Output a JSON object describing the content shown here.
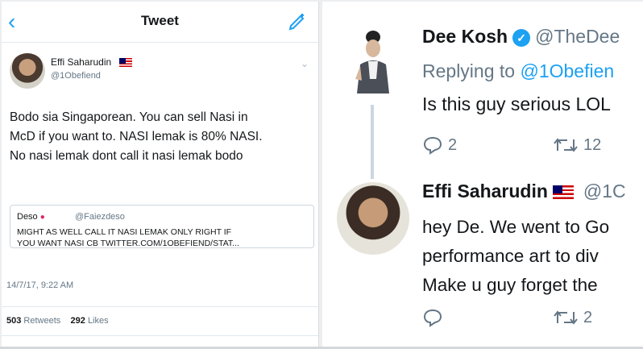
{
  "left": {
    "header_title": "Tweet",
    "back_icon": "‹",
    "author_name": "Effi Saharudin",
    "author_handle": "@1Obefiend",
    "tweet_lines": [
      "Bodo sia Singaporean. You can sell Nasi in",
      "McD if you want to. NASI lemak is 80% NASI.",
      "No nasi lemak dont call it nasi lemak bodo"
    ],
    "quote": {
      "name": "Deso",
      "handle": "@Faiezdeso",
      "text_lines": [
        "MIGHT AS WELL CALL IT NASI LEMAK ONLY RIGHT IF",
        "YOU WANT NASI CB twitter.com/1obefiend/stat..."
      ]
    },
    "timestamp": "14/7/17, 9:22 AM",
    "retweets": "503",
    "retweets_label": "Retweets",
    "likes": "292",
    "likes_label": "Likes"
  },
  "right": {
    "reply": {
      "name": "Dee Kosh",
      "handle": "@TheDee",
      "replying_prefix": "Replying to",
      "replying_to": "@1Obefien",
      "text": "Is this guy serious LOL",
      "replies": "2",
      "retweets": "12"
    },
    "answer": {
      "name": "Effi Saharudin",
      "handle": "@1C",
      "lines": [
        "hey De. We went to Go",
        "performance art to div",
        "Make u guy forget the"
      ],
      "retweets": "2"
    }
  },
  "colors": {
    "accent": "#1da1f2",
    "muted": "#657786",
    "text": "#14171a"
  }
}
